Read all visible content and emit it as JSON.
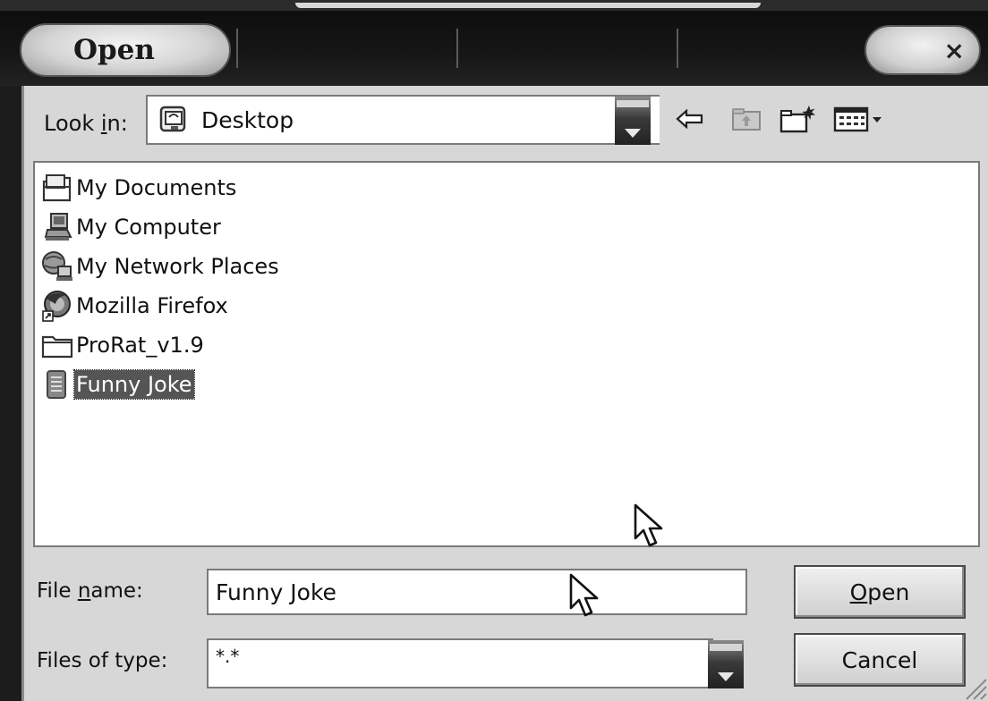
{
  "window": {
    "title": "Open",
    "close_symbol": "×"
  },
  "look_in": {
    "label_pre": "Look ",
    "label_accel": "i",
    "label_post": "n:",
    "value": "Desktop",
    "icon": "desktop-icon"
  },
  "toolbar": {
    "icons": [
      "back-arrow-icon",
      "up-folder-icon",
      "new-folder-icon",
      "view-menu-icon"
    ]
  },
  "files": [
    {
      "label": "My Documents",
      "icon": "my-documents-icon",
      "selected": false
    },
    {
      "label": "My Computer",
      "icon": "my-computer-icon",
      "selected": false
    },
    {
      "label": "My Network Places",
      "icon": "network-places-icon",
      "selected": false
    },
    {
      "label": "Mozilla Firefox",
      "icon": "firefox-shortcut-icon",
      "selected": false
    },
    {
      "label": "ProRat_v1.9",
      "icon": "folder-icon",
      "selected": false
    },
    {
      "label": "Funny Joke",
      "icon": "text-file-icon",
      "selected": true
    }
  ],
  "file_name": {
    "label_pre": "File ",
    "label_accel": "n",
    "label_post": "ame:",
    "value": "Funny Joke"
  },
  "file_type": {
    "label": "Files of type:",
    "value": "*.*"
  },
  "buttons": {
    "open_accel": "O",
    "open_rest": "pen",
    "cancel": "Cancel"
  },
  "colors": {
    "selection": "#555555",
    "dialog_bg": "#d7d7d7",
    "titlebar": "#161616"
  }
}
